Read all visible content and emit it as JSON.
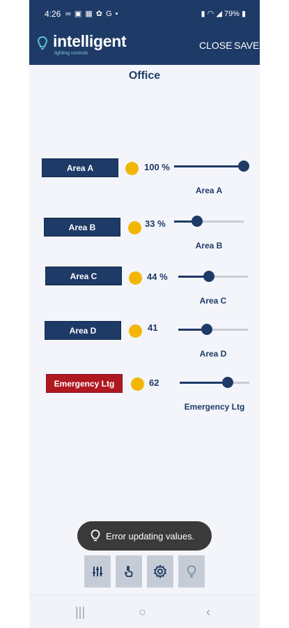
{
  "status_bar": {
    "time": "4:26",
    "left_icons": "∞ ▣ ▦ ✿ G •",
    "battery": "79%"
  },
  "header": {
    "brand": "intelligent",
    "tagline": "lighting controls",
    "close_label": "CLOSE",
    "save_label": "SAVE"
  },
  "page": {
    "title": "Office"
  },
  "areas": [
    {
      "button": "Area A",
      "value": "100 %",
      "level": 1.0,
      "label": "Area A"
    },
    {
      "button": "Area B",
      "value": "33 %",
      "level": 0.33,
      "label": "Area B"
    },
    {
      "button": "Area C",
      "value": "44 %",
      "level": 0.44,
      "label": "Area C"
    },
    {
      "button": "Area D",
      "value": "41",
      "level": 0.41,
      "label": "Area D"
    },
    {
      "button": "Emergency Ltg",
      "value": "62",
      "level": 0.69,
      "label": "Emergency Ltg"
    }
  ],
  "toast": {
    "message": "Error updating values."
  },
  "bottom_nav": [
    "sliders-icon",
    "touch-icon",
    "gear-icon",
    "bulb-icon"
  ],
  "colors": {
    "primary": "#1e3a66",
    "accent": "#f2b705",
    "danger": "#b01820"
  }
}
